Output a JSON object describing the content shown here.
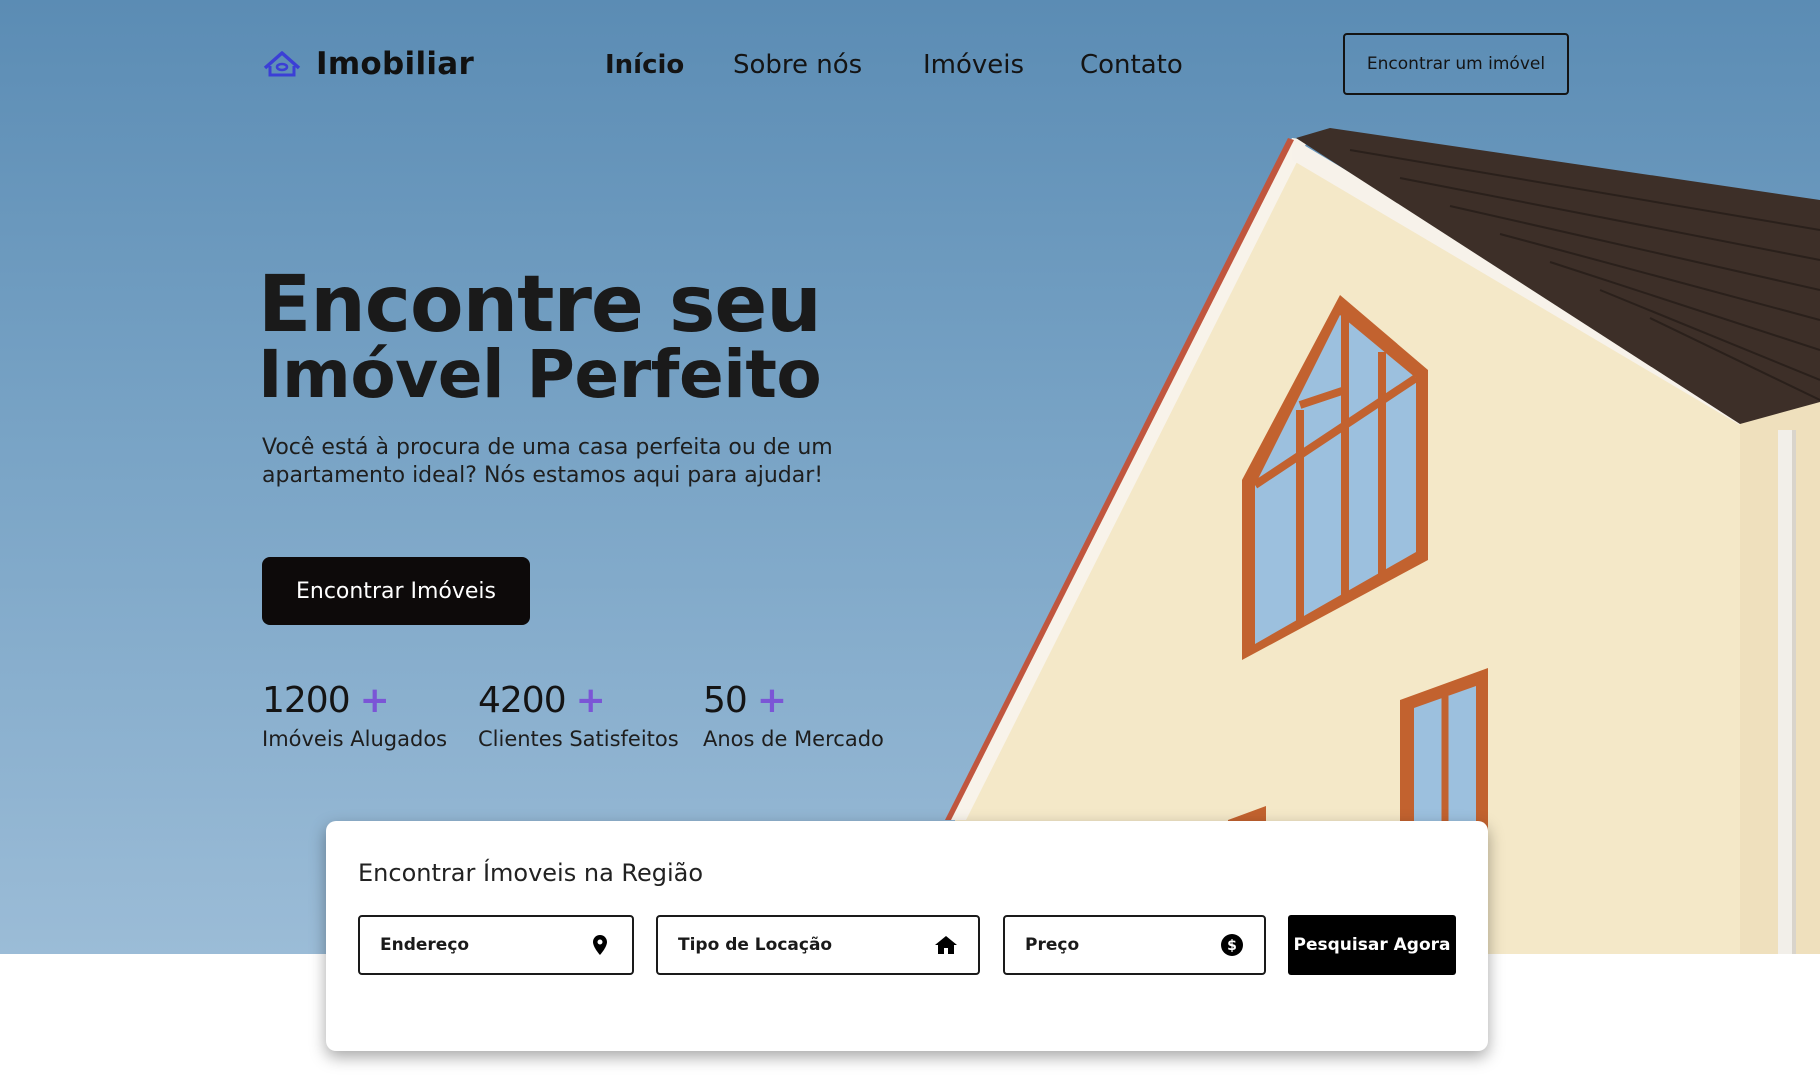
{
  "brand": {
    "name": "Imobiliar",
    "icon": "house-roof-icon",
    "accent": "#3b3fd6"
  },
  "nav": {
    "items": [
      {
        "label": "Início",
        "active": true
      },
      {
        "label": "Sobre nós",
        "active": false
      },
      {
        "label": "Imóveis",
        "active": false
      },
      {
        "label": "Contato",
        "active": false
      }
    ],
    "cta_label": "Encontrar um imóvel"
  },
  "hero": {
    "title_line1": "Encontre seu",
    "title_line2": "Imóvel Perfeito",
    "subtitle": "Você está à procura de uma casa perfeita ou de um apartamento ideal? Nós estamos aqui para ajudar!",
    "cta_label": "Encontrar Imóveis",
    "stats": [
      {
        "value": "1200",
        "suffix": "+",
        "label": "Imóveis Alugados"
      },
      {
        "value": "4200",
        "suffix": "+",
        "label": "Clientes Satisfeitos"
      },
      {
        "value": "50",
        "suffix": "+",
        "label": "Anos de Mercado"
      }
    ],
    "stat_accent": "#7b55d6"
  },
  "search": {
    "title": "Encontrar Ímoveis na Região",
    "fields": [
      {
        "placeholder": "Endereço",
        "icon": "map-pin-icon"
      },
      {
        "placeholder": "Tipo de Locação",
        "icon": "home-icon"
      },
      {
        "placeholder": "Preço",
        "icon": "dollar-circle-icon"
      }
    ],
    "button_label": "Pesquisar Agora"
  }
}
